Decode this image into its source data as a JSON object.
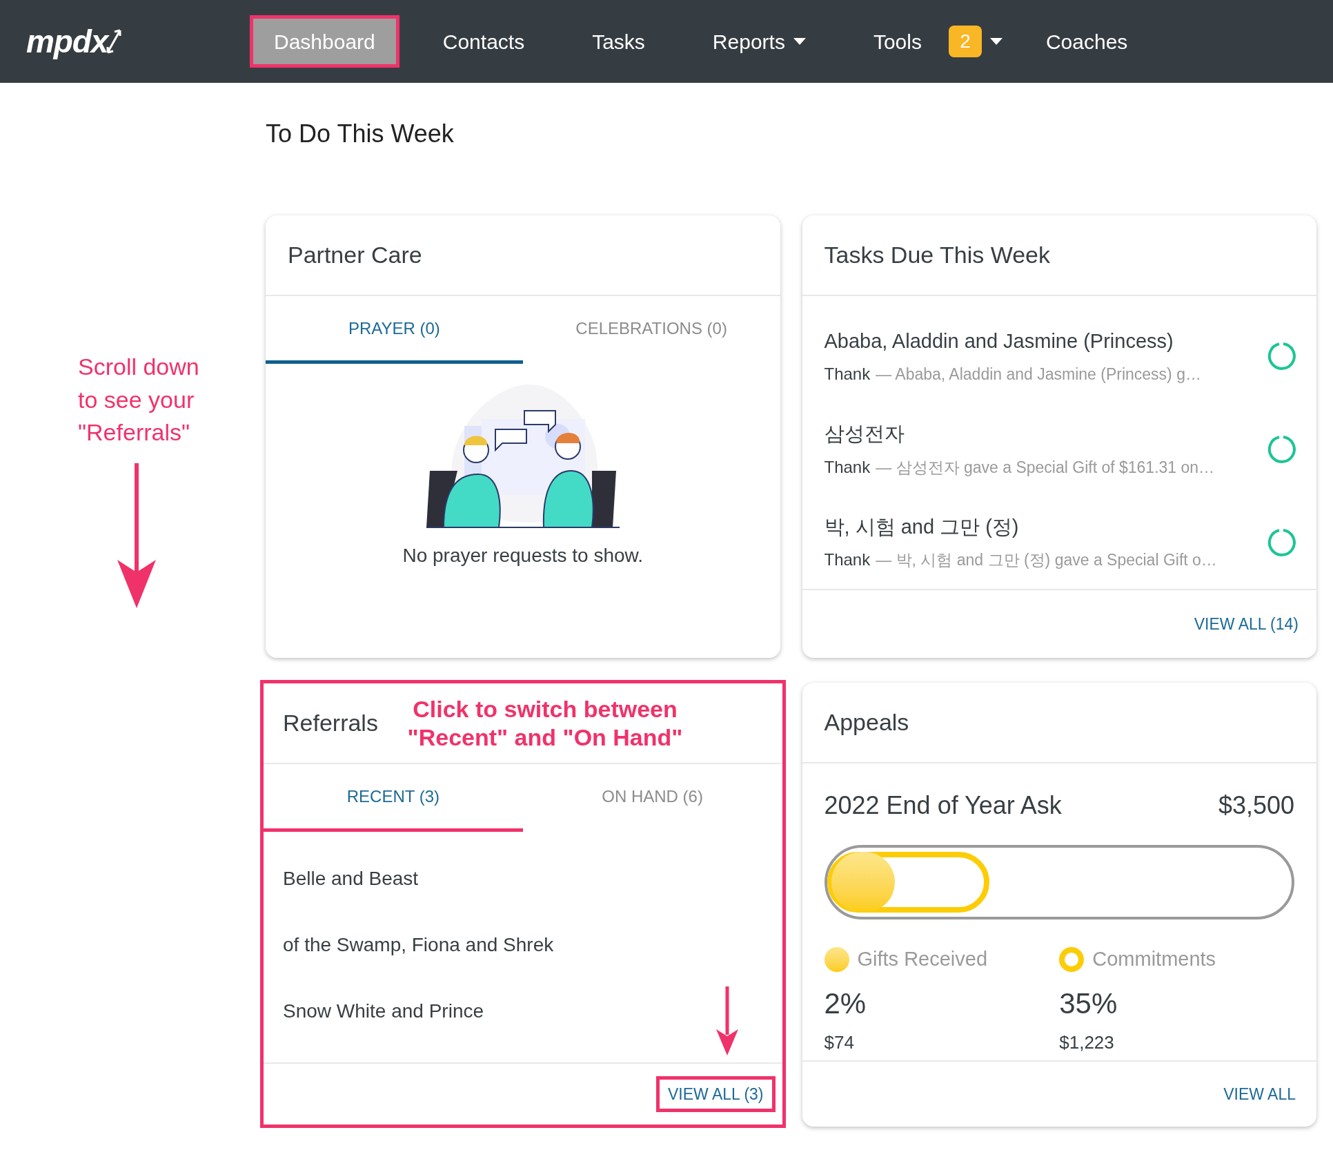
{
  "navbar": {
    "logo": "mpdx",
    "items": [
      {
        "label": "Dashboard",
        "selected": true,
        "highlighted": true,
        "dropdown": false
      },
      {
        "label": "Contacts",
        "selected": false,
        "highlighted": false,
        "dropdown": false
      },
      {
        "label": "Tasks",
        "selected": false,
        "highlighted": false,
        "dropdown": false
      },
      {
        "label": "Reports",
        "selected": false,
        "highlighted": false,
        "dropdown": true
      },
      {
        "label": "Tools",
        "selected": false,
        "highlighted": false,
        "dropdown": true,
        "badge": "2"
      },
      {
        "label": "Coaches",
        "selected": false,
        "highlighted": false,
        "dropdown": false
      }
    ]
  },
  "page_title": "To Do This Week",
  "side_note": {
    "text": "Scroll down to see your \"Referrals\""
  },
  "partner_care": {
    "title": "Partner Care",
    "tabs": [
      {
        "label": "PRAYER (0)",
        "selected": true
      },
      {
        "label": "CELEBRATIONS (0)",
        "selected": false
      }
    ],
    "empty_text": "No prayer requests to show."
  },
  "tasks": {
    "title": "Tasks Due This Week",
    "items": [
      {
        "name": "Ababa, Aladdin and Jasmine (Princess)",
        "action": "Thank",
        "description": "— Ababa, Aladdin and Jasmine (Princess) g…",
        "done": false
      },
      {
        "name": "삼성전자",
        "action": "Thank",
        "description": "— 삼성전자 gave a Special Gift of $161.31 on…",
        "done": false
      },
      {
        "name": "박, 시험 and 그만 (정)",
        "action": "Thank",
        "description": "— 박, 시험 and 그만 (정) gave a Special Gift o…",
        "done": false
      }
    ],
    "view_all": "VIEW ALL (14)"
  },
  "referrals": {
    "title": "Referrals",
    "highlighted": true,
    "note": "Click to switch between \"Recent\" and \"On Hand\"",
    "tabs": [
      {
        "label": "RECENT (3)",
        "selected": true
      },
      {
        "label": "ON HAND (6)",
        "selected": false
      }
    ],
    "items": [
      "Belle and Beast",
      "of the Swamp, Fiona and Shrek",
      "Snow White and Prince"
    ],
    "view_all": {
      "label": "VIEW ALL (3)",
      "highlighted": true
    }
  },
  "appeals": {
    "title": "Appeals",
    "name": "2022 End of Year Ask",
    "goal": "$3,500",
    "gifts": {
      "label": "Gifts Received",
      "percent": "2%",
      "amount": "$74",
      "level": 0.02
    },
    "commitments": {
      "label": "Commitments",
      "percent": "35%",
      "amount": "$1,223",
      "level": 0.35
    },
    "view_all": "VIEW ALL"
  }
}
